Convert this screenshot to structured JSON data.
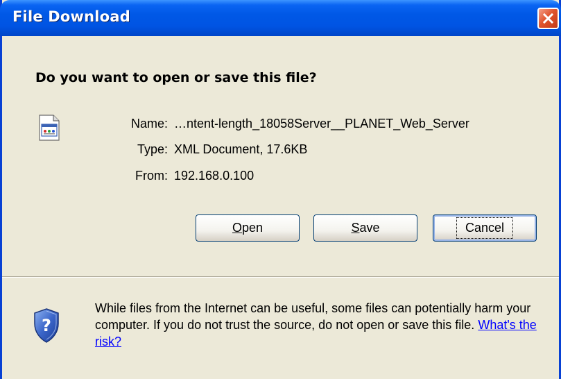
{
  "window": {
    "title": "File Download"
  },
  "dialog": {
    "question": "Do you want to open or save this file?",
    "file": {
      "name_label": "Name:",
      "name_value": "…ntent-length_18058Server__PLANET_Web_Server",
      "type_label": "Type:",
      "type_value": "XML Document, 17.6KB",
      "from_label": "From:",
      "from_value": "192.168.0.100"
    },
    "buttons": {
      "open_accel": "O",
      "open_rest": "pen",
      "save_accel": "S",
      "save_rest": "ave",
      "cancel": "Cancel"
    },
    "warning": {
      "text": "While files from the Internet can be useful, some files can potentially harm your computer. If you do not trust the source, do not open or save this file.",
      "link": "What's the risk?"
    }
  },
  "icons": {
    "file": "xml-document-icon",
    "warning": "shield-question-icon",
    "close": "close-icon"
  },
  "colors": {
    "titlebar": "#0054e3",
    "dialog_bg": "#ece9d8",
    "close_button": "#e0552f",
    "link": "#0000ff"
  }
}
